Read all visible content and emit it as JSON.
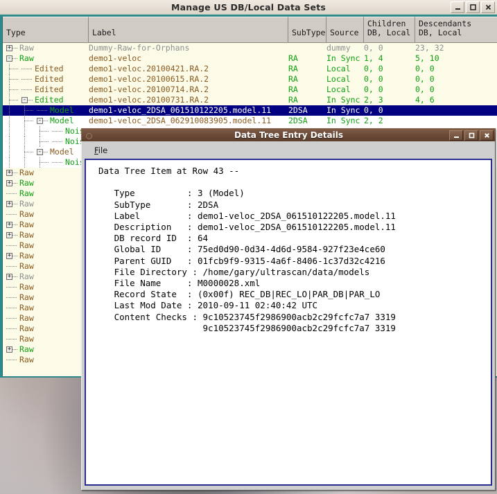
{
  "main_window": {
    "title": "Manage US DB/Local Data Sets",
    "buttons": [
      {
        "name": "minimize",
        "glyph": "_"
      },
      {
        "name": "maximize",
        "glyph": "□"
      },
      {
        "name": "close",
        "glyph": "✖"
      }
    ],
    "columns": [
      {
        "label": "Type"
      },
      {
        "label": "Label"
      },
      {
        "label": "SubType"
      },
      {
        "label": "Source"
      },
      {
        "label": "Children\nDB, Local"
      },
      {
        "label": "Descendants\nDB, Local"
      }
    ],
    "rows": [
      {
        "type": "Raw",
        "label": "Dummy-Raw-for-Orphans",
        "subtype": "",
        "source": "dummy",
        "children": "0, 0",
        "descendants": "23, 32",
        "depth": 0,
        "expander": "+",
        "color": "grey",
        "bg": "alt",
        "selected": false
      },
      {
        "type": "Raw",
        "label": "demo1-veloc",
        "subtype": "RA",
        "source": "In Sync",
        "children": "1, 4",
        "descendants": "5, 10",
        "depth": 0,
        "expander": "-",
        "color": "green",
        "bg": "alt",
        "selected": false
      },
      {
        "type": "Edited",
        "label": "demo1-veloc.20100421.RA.2",
        "subtype": "RA",
        "source": "Local",
        "children": "0, 0",
        "descendants": "0, 0",
        "depth": 1,
        "expander": "",
        "color": "raw",
        "bg": "alt",
        "selected": false
      },
      {
        "type": "Edited",
        "label": "demo1-veloc.20100615.RA.2",
        "subtype": "RA",
        "source": "Local",
        "children": "0, 0",
        "descendants": "0, 0",
        "depth": 1,
        "expander": "",
        "color": "raw",
        "bg": "alt",
        "selected": false
      },
      {
        "type": "Edited",
        "label": "demo1-veloc.20100714.RA.2",
        "subtype": "RA",
        "source": "Local",
        "children": "0, 0",
        "descendants": "0, 0",
        "depth": 1,
        "expander": "",
        "color": "raw",
        "bg": "alt",
        "selected": false
      },
      {
        "type": "Edited",
        "label": "demo1-veloc.20100731.RA.2",
        "subtype": "RA",
        "source": "In Sync",
        "children": "2, 3",
        "descendants": "4, 6",
        "depth": 1,
        "expander": "-",
        "color": "green",
        "bg": "alt",
        "selected": false
      },
      {
        "type": "Model",
        "label": "demo1-veloc_2DSA_061510122205.model.11",
        "subtype": "2DSA",
        "source": "In Sync",
        "children": "0, 0",
        "descendants": "",
        "depth": 2,
        "expander": "",
        "color": "green",
        "bg": "sel",
        "selected": true
      },
      {
        "type": "Model",
        "label": "demo1-veloc_2DSA_062910083905.model.11",
        "subtype": "2DSA",
        "source": "In Sync",
        "children": "2, 2",
        "descendants": "",
        "depth": 2,
        "expander": "-",
        "color": "green",
        "bg": "plain",
        "selected": false
      },
      {
        "type": "Noise",
        "label": "",
        "subtype": "",
        "source": "",
        "children": "",
        "descendants": "",
        "depth": 3,
        "expander": "",
        "color": "green",
        "bg": "plain",
        "selected": false
      },
      {
        "type": "Noise",
        "label": "",
        "subtype": "",
        "source": "",
        "children": "",
        "descendants": "",
        "depth": 3,
        "expander": "",
        "color": "green",
        "bg": "plain",
        "selected": false
      },
      {
        "type": "Model",
        "label": "",
        "subtype": "",
        "source": "",
        "children": "",
        "descendants": "",
        "depth": 2,
        "expander": "-",
        "color": "raw",
        "bg": "plain",
        "selected": false
      },
      {
        "type": "Noise",
        "label": "",
        "subtype": "",
        "source": "",
        "children": "",
        "descendants": "",
        "depth": 3,
        "expander": "",
        "color": "green",
        "bg": "plain",
        "selected": false
      },
      {
        "type": "Raw",
        "label": "",
        "subtype": "",
        "source": "",
        "children": "",
        "descendants": "",
        "depth": 0,
        "expander": "+",
        "color": "raw",
        "bg": "alt",
        "selected": false
      },
      {
        "type": "Raw",
        "label": "",
        "subtype": "",
        "source": "",
        "children": "",
        "descendants": "",
        "depth": 0,
        "expander": "+",
        "color": "green",
        "bg": "alt",
        "selected": false
      },
      {
        "type": "Raw",
        "label": "",
        "subtype": "",
        "source": "",
        "children": "",
        "descendants": "",
        "depth": 0,
        "expander": "",
        "color": "green",
        "bg": "alt",
        "selected": false
      },
      {
        "type": "Raw",
        "label": "",
        "subtype": "",
        "source": "",
        "children": "",
        "descendants": "",
        "depth": 0,
        "expander": "+",
        "color": "grey",
        "bg": "alt",
        "selected": false
      },
      {
        "type": "Raw",
        "label": "",
        "subtype": "",
        "source": "",
        "children": "",
        "descendants": "",
        "depth": 0,
        "expander": "",
        "color": "raw",
        "bg": "alt",
        "selected": false
      },
      {
        "type": "Raw",
        "label": "",
        "subtype": "",
        "source": "",
        "children": "",
        "descendants": "",
        "depth": 0,
        "expander": "+",
        "color": "raw",
        "bg": "alt",
        "selected": false
      },
      {
        "type": "Raw",
        "label": "",
        "subtype": "",
        "source": "",
        "children": "",
        "descendants": "",
        "depth": 0,
        "expander": "+",
        "color": "raw",
        "bg": "alt",
        "selected": false
      },
      {
        "type": "Raw",
        "label": "",
        "subtype": "",
        "source": "",
        "children": "",
        "descendants": "",
        "depth": 0,
        "expander": "",
        "color": "raw",
        "bg": "alt",
        "selected": false
      },
      {
        "type": "Raw",
        "label": "",
        "subtype": "",
        "source": "",
        "children": "",
        "descendants": "",
        "depth": 0,
        "expander": "+",
        "color": "raw",
        "bg": "alt",
        "selected": false
      },
      {
        "type": "Raw",
        "label": "",
        "subtype": "",
        "source": "",
        "children": "",
        "descendants": "",
        "depth": 0,
        "expander": "",
        "color": "raw",
        "bg": "alt",
        "selected": false
      },
      {
        "type": "Raw",
        "label": "",
        "subtype": "",
        "source": "",
        "children": "",
        "descendants": "",
        "depth": 0,
        "expander": "+",
        "color": "grey",
        "bg": "alt",
        "selected": false
      },
      {
        "type": "Raw",
        "label": "",
        "subtype": "",
        "source": "",
        "children": "",
        "descendants": "",
        "depth": 0,
        "expander": "",
        "color": "raw",
        "bg": "alt",
        "selected": false
      },
      {
        "type": "Raw",
        "label": "",
        "subtype": "",
        "source": "",
        "children": "",
        "descendants": "",
        "depth": 0,
        "expander": "",
        "color": "raw",
        "bg": "alt",
        "selected": false
      },
      {
        "type": "Raw",
        "label": "",
        "subtype": "",
        "source": "",
        "children": "",
        "descendants": "",
        "depth": 0,
        "expander": "",
        "color": "raw",
        "bg": "alt",
        "selected": false
      },
      {
        "type": "Raw",
        "label": "",
        "subtype": "",
        "source": "",
        "children": "",
        "descendants": "",
        "depth": 0,
        "expander": "",
        "color": "raw",
        "bg": "alt",
        "selected": false
      },
      {
        "type": "Raw",
        "label": "",
        "subtype": "",
        "source": "",
        "children": "",
        "descendants": "",
        "depth": 0,
        "expander": "",
        "color": "raw",
        "bg": "alt",
        "selected": false
      },
      {
        "type": "Raw",
        "label": "",
        "subtype": "",
        "source": "",
        "children": "",
        "descendants": "",
        "depth": 0,
        "expander": "",
        "color": "raw",
        "bg": "alt",
        "selected": false
      },
      {
        "type": "Raw",
        "label": "",
        "subtype": "",
        "source": "",
        "children": "",
        "descendants": "",
        "depth": 0,
        "expander": "+",
        "color": "green",
        "bg": "alt",
        "selected": false
      },
      {
        "type": "Raw",
        "label": "",
        "subtype": "",
        "source": "",
        "children": "",
        "descendants": "",
        "depth": 0,
        "expander": "",
        "color": "raw",
        "bg": "alt",
        "selected": false
      }
    ]
  },
  "dialog": {
    "title": "Data Tree Entry Details",
    "buttons": [
      {
        "name": "minimize",
        "glyph": "_"
      },
      {
        "name": "maximize",
        "glyph": "□"
      },
      {
        "name": "close",
        "glyph": "✖"
      }
    ],
    "menu": [
      {
        "label": "File",
        "mnemonic": "F"
      }
    ],
    "content": "Data Tree Item at Row 43 --\n\n   Type          : 3 (Model)\n   SubType       : 2DSA\n   Label         : demo1-veloc_2DSA_061510122205.model.11\n   Description   : demo1-veloc_2DSA_061510122205.model.11\n   DB record ID  : 64\n   Global ID     : 75ed0d90-0d34-4d6d-9584-927f23e4ce60\n   Parent GUID   : 01fcb9f9-9315-4a6f-8406-1c37d32c4216\n   File Directory : /home/gary/ultrascan/data/models\n   File Name     : M0000028.xml\n   Record State  : (0x00f) REC_DB|REC_LO|PAR_DB|PAR_LO\n   Last Mod Date : 2010-09-11 02:40:42 UTC\n   Content Checks : 9c10523745f2986900acb2c29fcfc7a7 3319\n                    9c10523745f2986900acb2c29fcfc7a7 3319"
  },
  "colors": {
    "selection": "#000080",
    "tree_bg": "#fbfbe8",
    "accent_teal": "#2d8a8a",
    "raw_text": "#8a5a1e",
    "sync_green": "#11a011",
    "dialog_title": "#6d4c39"
  }
}
